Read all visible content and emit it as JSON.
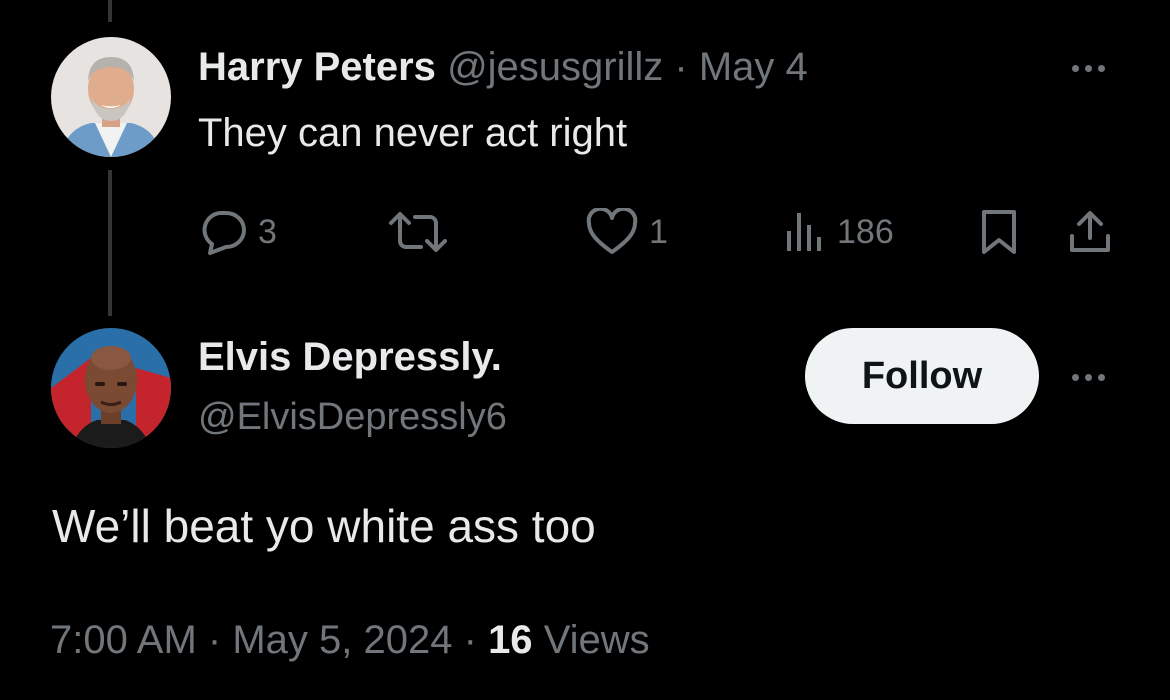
{
  "reply": {
    "display_name": "Harry Peters",
    "handle": "@jesusgrillz",
    "separator": "·",
    "date": "May 4",
    "text": "They can never act right",
    "avatar_icon": "avatar-gray-haired-man",
    "actions": {
      "replies": "3",
      "reposts": "",
      "likes": "1",
      "views": "186"
    }
  },
  "main": {
    "display_name": "Elvis Depressly.",
    "handle": "@ElvisDepressly6",
    "avatar_icon": "avatar-bald-man",
    "follow_label": "Follow",
    "text": "We’ll beat yo white ass too",
    "time": "7:00 AM",
    "sep1": "·",
    "date": "May 5, 2024",
    "sep2": "·",
    "views_count": "16",
    "views_label": "Views"
  },
  "colors": {
    "background": "#000000",
    "primary_text": "#e7e9ea",
    "secondary_text": "#71767b",
    "thread_line": "#333639",
    "follow_bg": "#eff3f4"
  }
}
